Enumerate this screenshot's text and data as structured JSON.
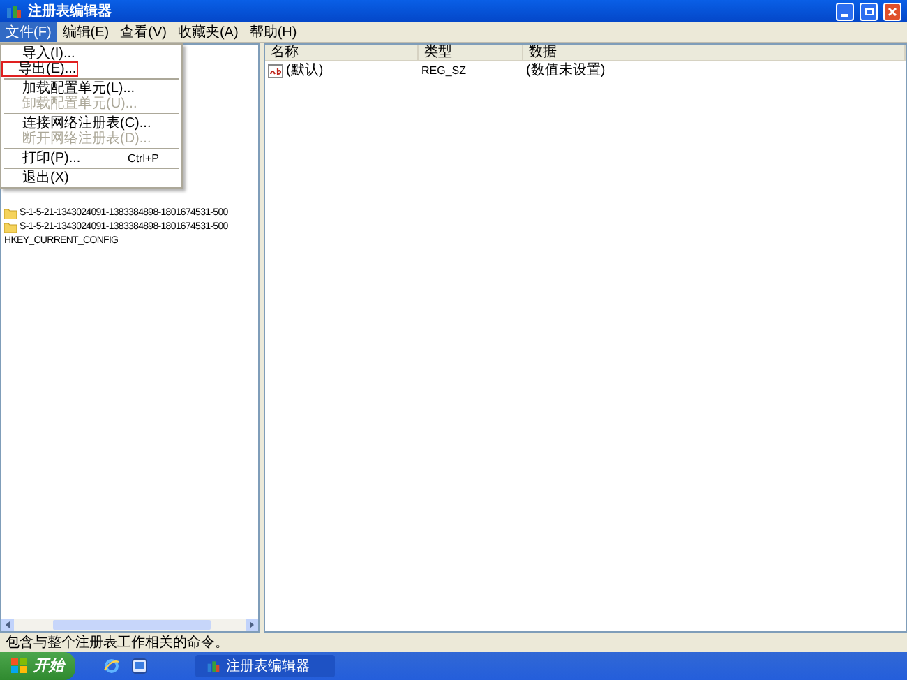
{
  "window": {
    "title": "注册表编辑器"
  },
  "menu_bar": [
    {
      "label": "文件(F)",
      "selected": true
    },
    {
      "label": "编辑(E)",
      "selected": false
    },
    {
      "label": "查看(V)",
      "selected": false
    },
    {
      "label": "收藏夹(A)",
      "selected": false
    },
    {
      "label": "帮助(H)",
      "selected": false
    }
  ],
  "file_menu": [
    {
      "kind": "item",
      "label": "导入(I)...",
      "disabled": false,
      "highlighted": false
    },
    {
      "kind": "item",
      "label": "导出(E)...",
      "disabled": false,
      "highlighted": true
    },
    {
      "kind": "separator"
    },
    {
      "kind": "item",
      "label": "加载配置单元(L)...",
      "disabled": false,
      "highlighted": false
    },
    {
      "kind": "item",
      "label": "卸载配置单元(U)...",
      "disabled": true,
      "highlighted": false
    },
    {
      "kind": "separator"
    },
    {
      "kind": "item",
      "label": "连接网络注册表(C)...",
      "disabled": false,
      "highlighted": false
    },
    {
      "kind": "item",
      "label": "断开网络注册表(D)...",
      "disabled": true,
      "highlighted": false
    },
    {
      "kind": "separator"
    },
    {
      "kind": "item",
      "label": "打印(P)...",
      "shortcut": "Ctrl+P",
      "disabled": false,
      "highlighted": false
    },
    {
      "kind": "separator"
    },
    {
      "kind": "item",
      "label": "退出(X)",
      "disabled": false,
      "highlighted": false
    }
  ],
  "tree": [
    {
      "kind": "folder",
      "label": "S-1-5-21-1343024091-1383384898-1801674531-500"
    },
    {
      "kind": "folder",
      "label": "S-1-5-21-1343024091-1383384898-1801674531-500"
    },
    {
      "kind": "plain",
      "label": "HKEY_CURRENT_CONFIG"
    }
  ],
  "table": {
    "columns": [
      "名称",
      "类型",
      "数据"
    ],
    "rows": [
      {
        "name": "(默认)",
        "type": "REG_SZ",
        "data": "(数值未设置)"
      }
    ]
  },
  "status_bar": "包含与整个注册表工作相关的命令。",
  "taskbar": {
    "start": "开始",
    "tasks": [
      "注册表编辑器"
    ]
  }
}
